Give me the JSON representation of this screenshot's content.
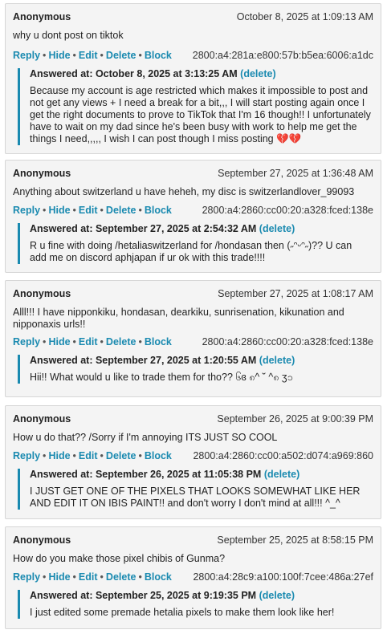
{
  "posts": [
    {
      "author": "Anonymous",
      "timestamp": "October 8, 2025 at 1:09:13 AM",
      "question": "why u dont post on tiktok",
      "actions": {
        "reply": "Reply",
        "hide": "Hide",
        "edit": "Edit",
        "delete": "Delete",
        "block": "Block"
      },
      "ip": "2800:a4:281a:e800:57b:b5ea:6006:a1dc",
      "answer_label": "Answered at: October 8, 2025 at 3:13:25 AM",
      "answer_delete": "(delete)",
      "answer": "Because my account is age restricted which makes it impossible to post and not get any views + I need a break for a bit,,, I will start posting again once I get the right documents to prove to TikTok that I'm 16 though!! I unfortunately have to wait on my dad since he's been busy with work to help me get the things I need,,,,, I wish I can post though I miss posting 💔💔"
    },
    {
      "author": "Anonymous",
      "timestamp": "September 27, 2025 at 1:36:48 AM",
      "question": "Anything about switzerland u have heheh, my disc is switzerlandlover_99093",
      "actions": {
        "reply": "Reply",
        "hide": "Hide",
        "edit": "Edit",
        "delete": "Delete",
        "block": "Block"
      },
      "ip": "2800:a4:2860:cc00:20:a328:fced:138e",
      "answer_label": "Answered at: September 27, 2025 at 2:54:32 AM",
      "answer_delete": "(delete)",
      "answer": "R u fine with doing /hetaliaswitzerland for /hondasan then (˶ᵔᵕᵔ˶)?? U can add me on discord aphjapan if ur ok with this trade!!!!"
    },
    {
      "author": "Anonymous",
      "timestamp": "September 27, 2025 at 1:08:17 AM",
      "question": "Alll!!! I have nipponkiku, hondasan, dearkiku, sunrisenation, kikunation and nipponaxis urls!!",
      "actions": {
        "reply": "Reply",
        "hide": "Hide",
        "edit": "Edit",
        "delete": "Delete",
        "block": "Block"
      },
      "ip": "2800:a4:2860:cc00:20:a328:fced:138e",
      "answer_label": "Answered at: September 27, 2025 at 1:20:55 AM",
      "answer_delete": "(delete)",
      "answer": "Hii!! What would u like to trade them for tho?? ၆ɞ ၈^ ˘ ^၈ ʒ၁"
    },
    {
      "author": "Anonymous",
      "timestamp": "September 26, 2025 at 9:00:39 PM",
      "question": "How u do that?? /Sorry if I'm annoying ITS JUST SO COOL",
      "actions": {
        "reply": "Reply",
        "hide": "Hide",
        "edit": "Edit",
        "delete": "Delete",
        "block": "Block"
      },
      "ip": "2800:a4:2860:cc00:a502:d074:a969:860",
      "answer_label": "Answered at: September 26, 2025 at 11:05:38 PM",
      "answer_delete": "(delete)",
      "answer": "I JUST GET ONE OF THE PIXELS THAT LOOKS SOMEWHAT LIKE HER AND EDIT IT ON IBIS PAINT!! and don't worry I don't mind at all!!! ^_^"
    },
    {
      "author": "Anonymous",
      "timestamp": "September 25, 2025 at 8:58:15 PM",
      "question": "How do you make those pixel chibis of Gunma?",
      "actions": {
        "reply": "Reply",
        "hide": "Hide",
        "edit": "Edit",
        "delete": "Delete",
        "block": "Block"
      },
      "ip": "2800:a4:28c9:a100:100f:7cee:486a:27ef",
      "answer_label": "Answered at: September 25, 2025 at 9:19:35 PM",
      "answer_delete": "(delete)",
      "answer": "I just edited some premade hetalia pixels to make them look like her!"
    }
  ]
}
